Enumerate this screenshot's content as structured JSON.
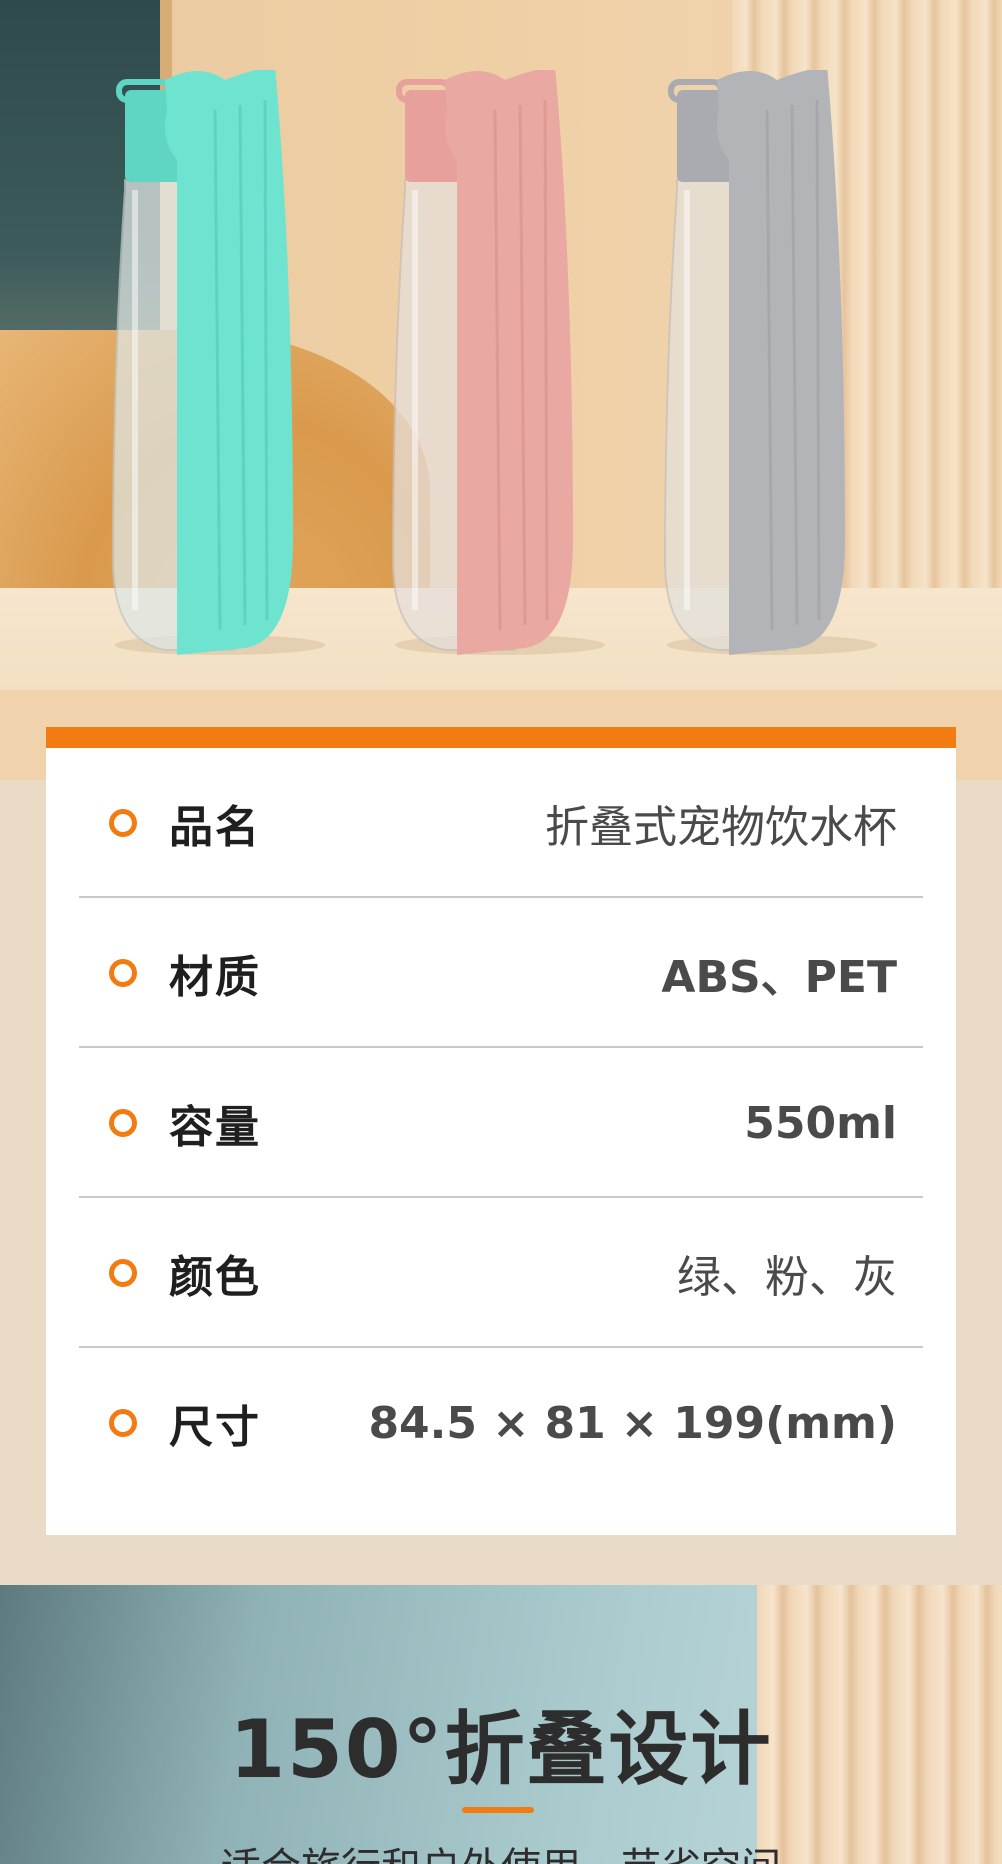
{
  "colors": {
    "accent": "#f27b12",
    "bottle_green": "#6ee3d0",
    "bottle_pink": "#eaa8a3",
    "bottle_gray": "#b3b4b8"
  },
  "product_images": [
    {
      "color": "green"
    },
    {
      "color": "pink"
    },
    {
      "color": "gray"
    }
  ],
  "specs": [
    {
      "icon": "orange-ring-bullet",
      "label": "品名",
      "value": "折叠式宠物饮水杯"
    },
    {
      "icon": "orange-ring-bullet",
      "label": "材质",
      "value": "ABS、PET"
    },
    {
      "icon": "orange-ring-bullet",
      "label": "容量",
      "value": "550ml"
    },
    {
      "icon": "orange-ring-bullet",
      "label": "颜色",
      "value": "绿、粉、灰"
    },
    {
      "icon": "orange-ring-bullet",
      "label": "尺寸",
      "value": "84.5 × 81 × 199(mm)"
    }
  ],
  "feature": {
    "headline": "150°折叠设计",
    "subline": "适合旅行和户外使用，节省空间"
  }
}
